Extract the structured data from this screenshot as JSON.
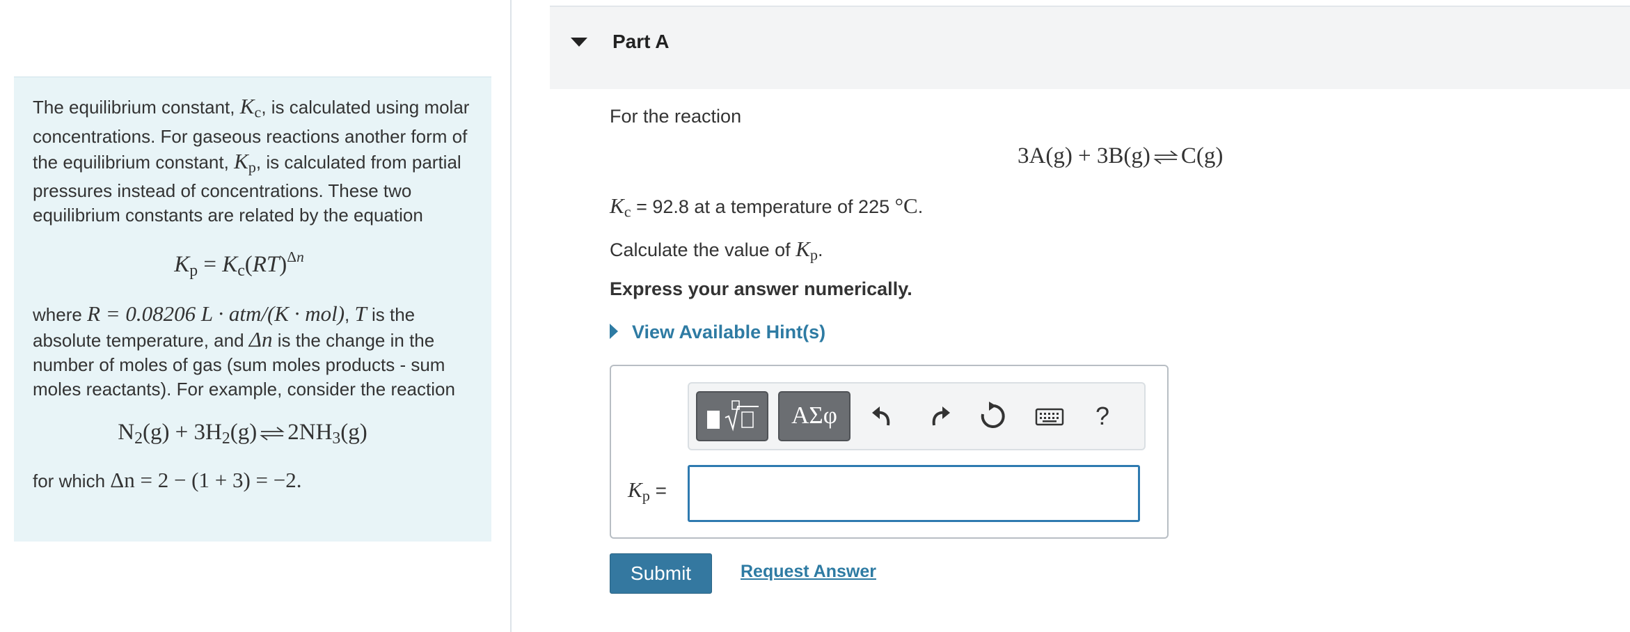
{
  "intro": {
    "p1_a": "The equilibrium constant,",
    "p1_b": ", is calculated using molar concentrations. For gaseous reactions another form of the equilibrium constant,",
    "p1_c": ", is calculated from partial pressures instead of concentrations. These two equilibrium constants are related by the equation",
    "p2_a": "where",
    "p2_r": "R = 0.08206 L · atm/(K · mol)",
    "p2_b": ",",
    "p2_t": "T",
    "p2_c": "is the absolute temperature, and",
    "p2_dn": "Δn",
    "p2_d": "is the change in the number of moles of gas (sum moles products - sum moles reactants). For example, consider the reaction",
    "p3_a": "for which",
    "p3_eq": "Δn = 2 − (1 + 3) = −2."
  },
  "part": {
    "title": "Part A"
  },
  "problem": {
    "for_reaction": "For the reaction",
    "kc_value_text": "= 92.8 at a temperature of 225",
    "deg_unit": "°C",
    "period": ".",
    "calc_text": "Calculate the value of",
    "express": "Express your answer numerically.",
    "hint_label": "View Available Hint(s)"
  },
  "toolbar": {
    "greek_label": "ΑΣφ",
    "help_label": "?"
  },
  "answer": {
    "label_eq": "=",
    "value": ""
  },
  "actions": {
    "submit": "Submit",
    "request": "Request Answer"
  },
  "icons": [
    "caret-down-icon",
    "caret-right-icon",
    "templates-icon",
    "undo-icon",
    "redo-icon",
    "reset-icon",
    "keyboard-icon"
  ],
  "colors": {
    "link": "#2e7ba3",
    "submit_bg": "#3478a0",
    "intro_bg": "#e8f4f7",
    "input_border": "#2f7ab0"
  }
}
